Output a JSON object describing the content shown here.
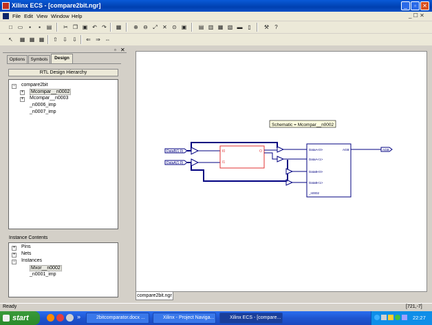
{
  "window": {
    "title": "Xilinx ECS - [compare2bit.ngr]"
  },
  "menu": {
    "items": [
      "File",
      "Edit",
      "View",
      "Window",
      "Help"
    ],
    "right_controls": "_ ☐ ✕"
  },
  "left_panel": {
    "tabs": [
      "Options",
      "Symbols",
      "Design"
    ],
    "active_tab": "Design",
    "hierarchy_header": "RTL Design Hierarchy",
    "hierarchy": [
      {
        "label": "compare2bit",
        "expander": "−"
      },
      {
        "label": "Mcompar__n0002",
        "expander": "+"
      },
      {
        "label": "Mcompar__n0003",
        "expander": "+"
      },
      {
        "label": "_n0006_imp",
        "expander": ""
      },
      {
        "label": "_n0007_imp",
        "expander": ""
      }
    ],
    "instance_header": "Instance Contents",
    "instances": [
      {
        "label": "Pins",
        "expander": "+"
      },
      {
        "label": "Nets",
        "expander": "+"
      },
      {
        "label": "Instances",
        "expander": "−"
      },
      {
        "label": "Mxor__n0002",
        "expander": ""
      },
      {
        "label": "_n0001_imp",
        "expander": ""
      }
    ]
  },
  "schematic": {
    "tooltip": "Schematic = Mcompar__n0002",
    "input_a": "DataB(1:0)",
    "input_b": "DataA(1:0)",
    "reg_pin_d": "I0",
    "reg_pin_i": "I1",
    "reg_pin_o": "O",
    "mux_pins": [
      "DataA<0>",
      "DataA<1>",
      "DataB<0>",
      "DataB<1>",
      "_n0002"
    ],
    "mux_out": "AGB",
    "output_port": "AGB"
  },
  "document_tab": "compare2bit.ngr",
  "status": {
    "left": "Ready",
    "coords": "[721,-7]"
  },
  "taskbar": {
    "start": "start",
    "tasks": [
      "2bitcomparator.docx ...",
      "Xilinx - Project Naviga...",
      "Xilinx ECS - [compare..."
    ],
    "quick_launch_more": "»",
    "clock": "22:27"
  }
}
